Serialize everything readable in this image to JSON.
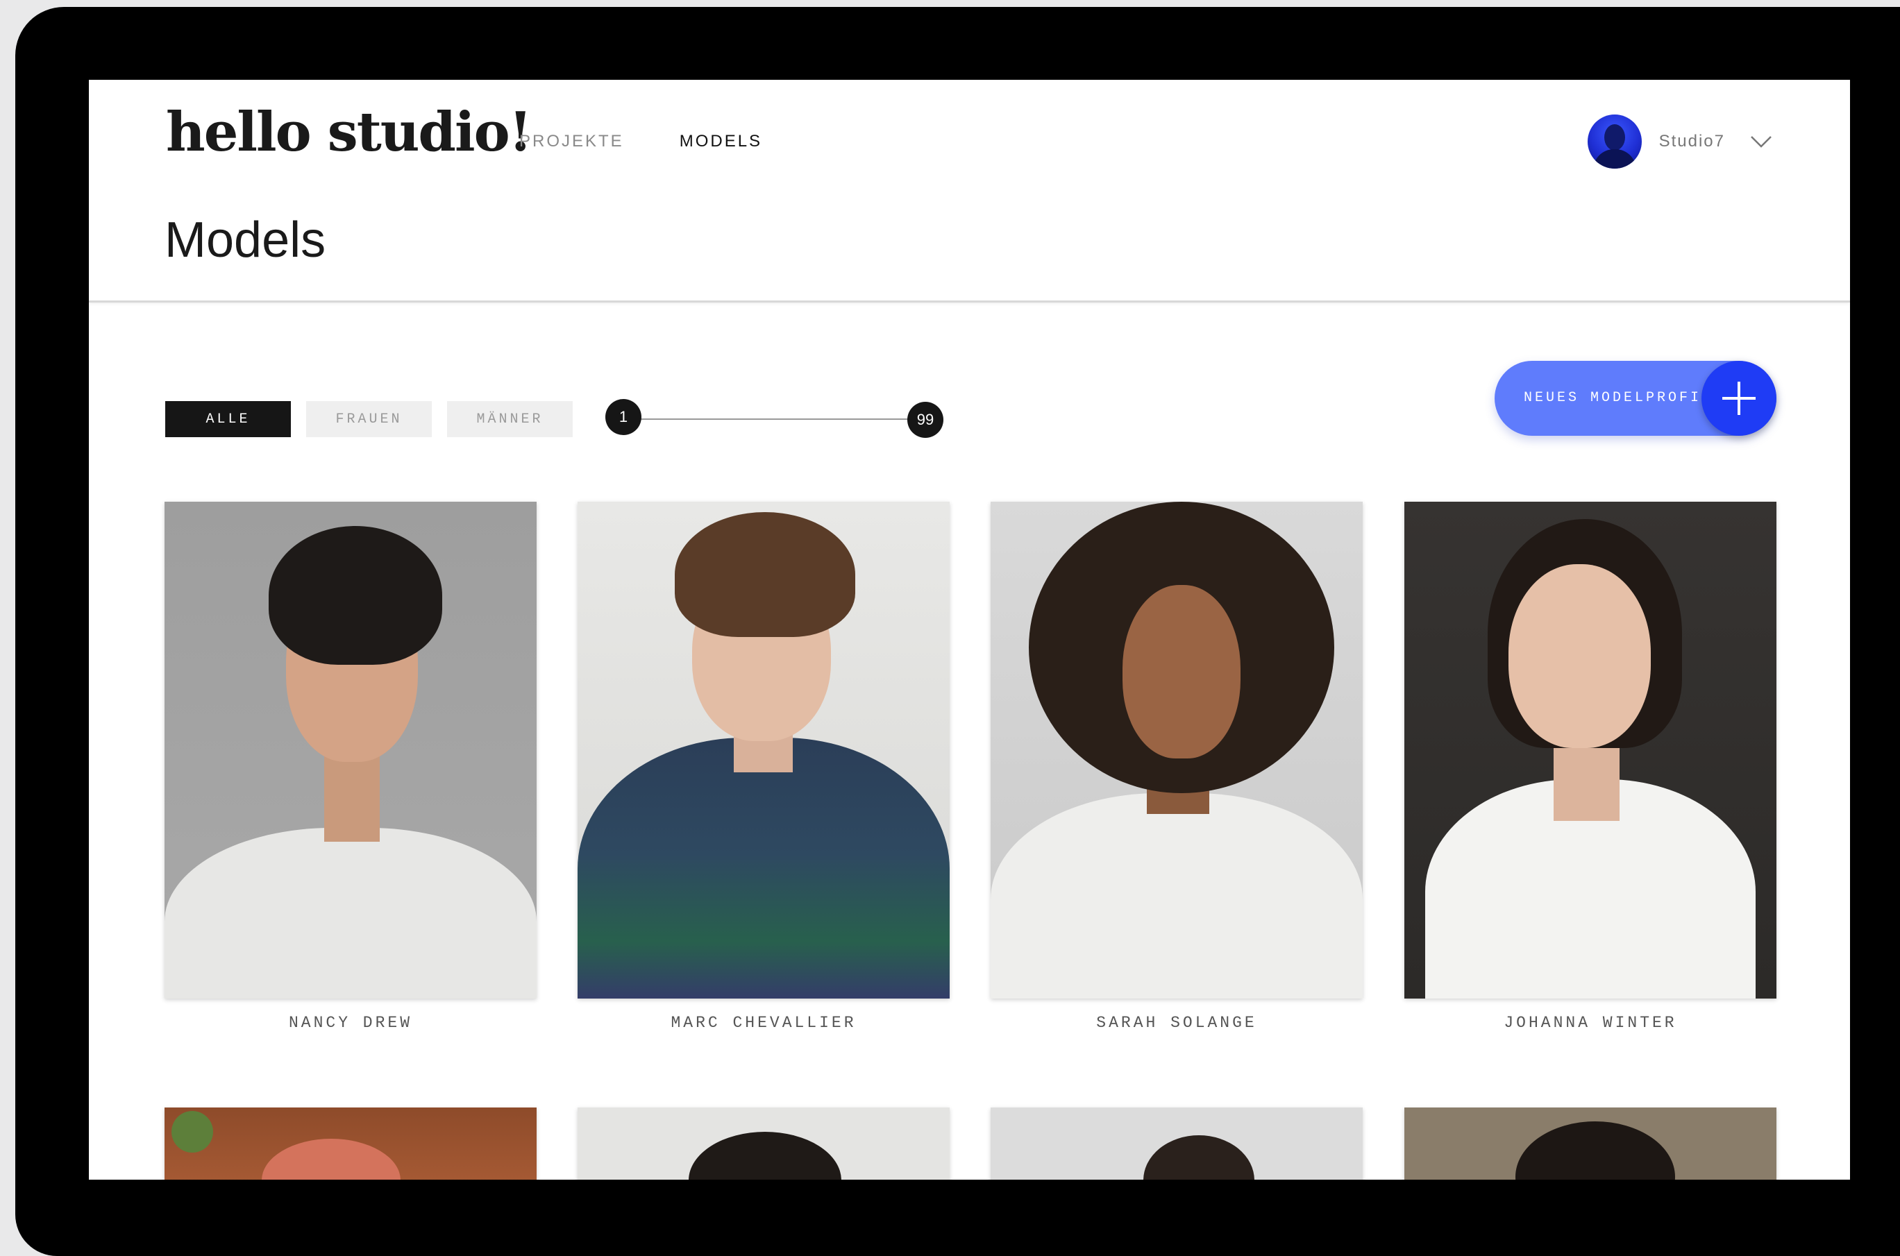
{
  "app": {
    "logo": "hello studio!"
  },
  "nav": {
    "items": [
      {
        "label": "PROJEKTE",
        "active": false
      },
      {
        "label": "MODELS",
        "active": true
      }
    ]
  },
  "user": {
    "name": "Studio7"
  },
  "page": {
    "title": "Models"
  },
  "filters": {
    "items": [
      {
        "label": "ALLE",
        "active": true
      },
      {
        "label": "FRAUEN",
        "active": false
      },
      {
        "label": "MÄNNER",
        "active": false
      }
    ]
  },
  "age_range": {
    "min": "1",
    "max": "99"
  },
  "actions": {
    "new_profile_label": "NEUES MODELPROFIL"
  },
  "models": [
    {
      "name": "NANCY DREW"
    },
    {
      "name": "MARC CHEVALLIER"
    },
    {
      "name": "SARAH SOLANGE"
    },
    {
      "name": "JOHANNA WINTER"
    }
  ],
  "icons": {
    "add": "plus-icon",
    "dropdown": "chevron-down-icon",
    "avatar": "avatar"
  },
  "colors": {
    "accent": "#5f7cfc",
    "accent_dark": "#1f3cf5",
    "dark": "#161616"
  }
}
